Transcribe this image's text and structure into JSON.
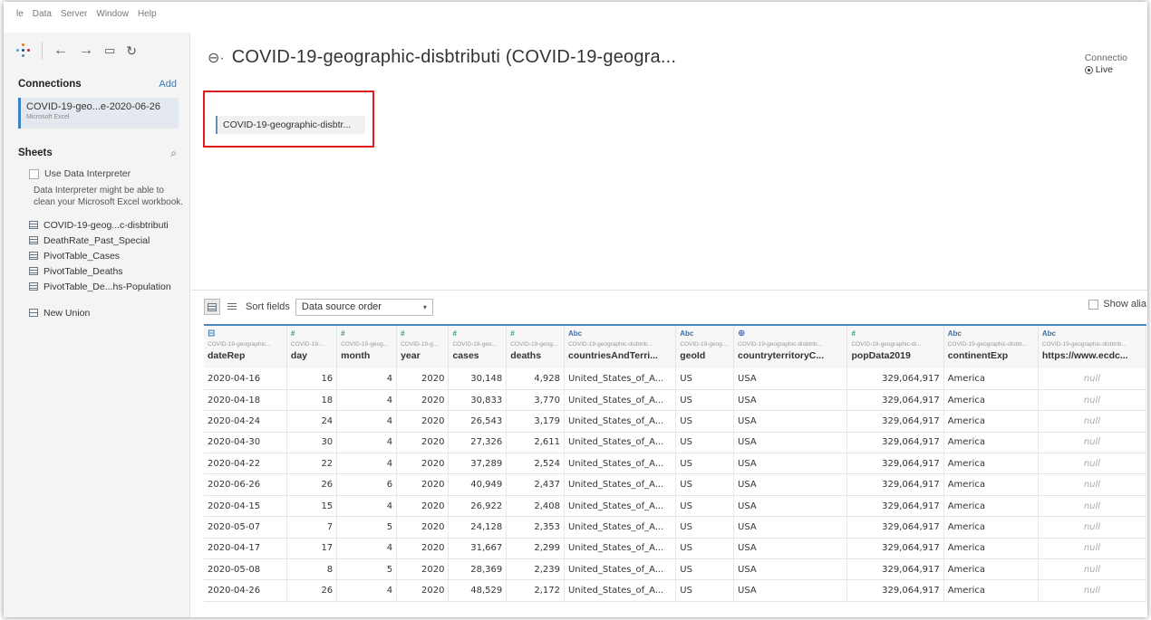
{
  "menu": [
    "le",
    "Data",
    "Server",
    "Window",
    "Help"
  ],
  "sidebar": {
    "connections_title": "Connections",
    "add_label": "Add",
    "connection": {
      "name": "COVID-19-geo...e-2020-06-26",
      "type": "Microsoft Excel"
    },
    "sheets_title": "Sheets",
    "interpreter_label": "Use Data Interpreter",
    "interpreter_desc": "Data Interpreter might be able to clean your Microsoft Excel workbook.",
    "sheets": [
      "COVID-19-geog...c-disbtributi",
      "DeathRate_Past_Special",
      "PivotTable_Cases",
      "PivotTable_Deaths",
      "PivotTable_De...hs-Population"
    ],
    "new_union": "New Union"
  },
  "main": {
    "title": "COVID-19-geographic-disbtributi (COVID-19-geogra...",
    "connection_label": "Connectio",
    "live_label": "Live",
    "table_chip": "COVID-19-geographic-disbtr...",
    "sort_label": "Sort fields",
    "sort_value": "Data source order",
    "show_alias": "Show alia"
  },
  "colors": {
    "accent": "#4a87bf",
    "highlight": "#e01a1a"
  },
  "grid": {
    "columns": [
      {
        "icon": "calendar-icon",
        "type": "",
        "src": "COVID-19-geographic...",
        "name": "dateRep",
        "align": "left",
        "width": 86
      },
      {
        "icon": "number-icon",
        "type": "#",
        "src": "COVID-19-...",
        "name": "day",
        "align": "right",
        "width": 52
      },
      {
        "icon": "number-icon",
        "type": "#",
        "src": "COVID-19-geog...",
        "name": "month",
        "align": "right",
        "width": 62
      },
      {
        "icon": "number-icon",
        "type": "#",
        "src": "COVID-19-g...",
        "name": "year",
        "align": "right",
        "width": 54
      },
      {
        "icon": "number-icon",
        "type": "#",
        "src": "COVID-19-geo...",
        "name": "cases",
        "align": "right",
        "width": 60
      },
      {
        "icon": "number-icon",
        "type": "#",
        "src": "COVID-19-geog...",
        "name": "deaths",
        "align": "right",
        "width": 60
      },
      {
        "icon": "string-icon",
        "type": "Abc",
        "src": "COVID-19-geographic-disbtrib...",
        "name": "countriesAndTerri...",
        "align": "left",
        "width": 116
      },
      {
        "icon": "string-icon",
        "type": "Abc",
        "src": "COVID-19-geogra...",
        "name": "geoId",
        "align": "left",
        "width": 60
      },
      {
        "icon": "globe-icon",
        "type": "",
        "src": "COVID-19-geographic-disbtrib...",
        "name": "countryterritoryC...",
        "align": "left",
        "width": 118
      },
      {
        "icon": "number-icon",
        "type": "#",
        "src": "COVID-19-geographic-di...",
        "name": "popData2019",
        "align": "right",
        "width": 100
      },
      {
        "icon": "string-icon",
        "type": "Abc",
        "src": "COVID-19-geographic-disbtr...",
        "name": "continentExp",
        "align": "left",
        "width": 98
      },
      {
        "icon": "string-icon",
        "type": "Abc",
        "src": "COVID-19-geographic-disbtrib...",
        "name": "https://www.ecdc...",
        "align": "null",
        "width": 112
      }
    ],
    "rows": [
      [
        "2020-04-16",
        "16",
        "4",
        "2020",
        "30,148",
        "4,928",
        "United_States_of_A...",
        "US",
        "USA",
        "329,064,917",
        "America",
        "null"
      ],
      [
        "2020-04-18",
        "18",
        "4",
        "2020",
        "30,833",
        "3,770",
        "United_States_of_A...",
        "US",
        "USA",
        "329,064,917",
        "America",
        "null"
      ],
      [
        "2020-04-24",
        "24",
        "4",
        "2020",
        "26,543",
        "3,179",
        "United_States_of_A...",
        "US",
        "USA",
        "329,064,917",
        "America",
        "null"
      ],
      [
        "2020-04-30",
        "30",
        "4",
        "2020",
        "27,326",
        "2,611",
        "United_States_of_A...",
        "US",
        "USA",
        "329,064,917",
        "America",
        "null"
      ],
      [
        "2020-04-22",
        "22",
        "4",
        "2020",
        "37,289",
        "2,524",
        "United_States_of_A...",
        "US",
        "USA",
        "329,064,917",
        "America",
        "null"
      ],
      [
        "2020-06-26",
        "26",
        "6",
        "2020",
        "40,949",
        "2,437",
        "United_States_of_A...",
        "US",
        "USA",
        "329,064,917",
        "America",
        "null"
      ],
      [
        "2020-04-15",
        "15",
        "4",
        "2020",
        "26,922",
        "2,408",
        "United_States_of_A...",
        "US",
        "USA",
        "329,064,917",
        "America",
        "null"
      ],
      [
        "2020-05-07",
        "7",
        "5",
        "2020",
        "24,128",
        "2,353",
        "United_States_of_A...",
        "US",
        "USA",
        "329,064,917",
        "America",
        "null"
      ],
      [
        "2020-04-17",
        "17",
        "4",
        "2020",
        "31,667",
        "2,299",
        "United_States_of_A...",
        "US",
        "USA",
        "329,064,917",
        "America",
        "null"
      ],
      [
        "2020-05-08",
        "8",
        "5",
        "2020",
        "28,369",
        "2,239",
        "United_States_of_A...",
        "US",
        "USA",
        "329,064,917",
        "America",
        "null"
      ],
      [
        "2020-04-26",
        "26",
        "4",
        "2020",
        "48,529",
        "2,172",
        "United_States_of_A...",
        "US",
        "USA",
        "329,064,917",
        "America",
        "null"
      ]
    ]
  }
}
